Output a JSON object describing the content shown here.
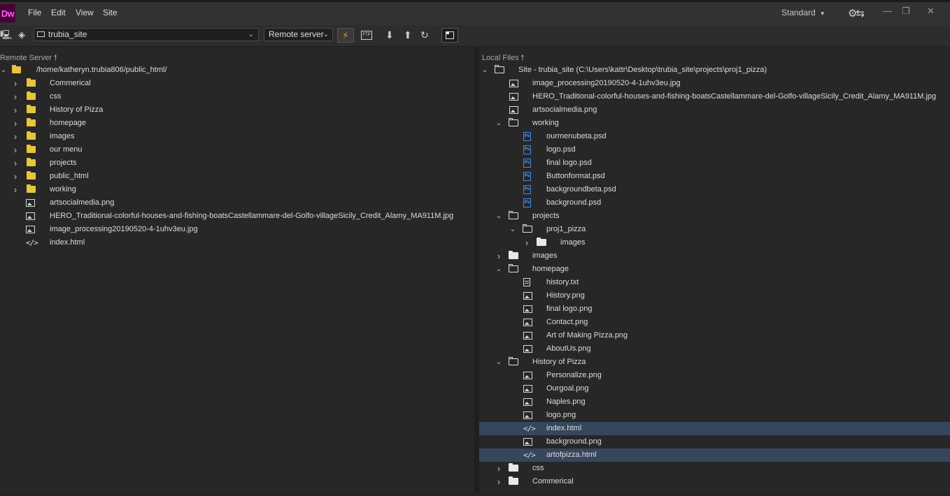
{
  "app": {
    "logo_text": "Dw",
    "accent": "#ff61f6",
    "logo_bg": "#470137"
  },
  "menu": [
    "File",
    "Edit",
    "View",
    "Site"
  ],
  "workspace": {
    "label": "Standard"
  },
  "toolbar": {
    "site_name": "trubia_site",
    "server_view": "Remote server",
    "icons": [
      "connect-icon",
      "ftp-log-icon",
      "get-down-arrow-icon",
      "put-up-arrow-icon",
      "refresh-icon",
      "expand-panel-icon"
    ]
  },
  "remote": {
    "header": "Remote Server",
    "root": "/home/katheryn.trubia806/public_html/",
    "items": [
      {
        "name": "Commerical",
        "type": "folder"
      },
      {
        "name": "css",
        "type": "folder"
      },
      {
        "name": "History of Pizza",
        "type": "folder"
      },
      {
        "name": "homepage",
        "type": "folder"
      },
      {
        "name": "images",
        "type": "folder"
      },
      {
        "name": "our menu",
        "type": "folder"
      },
      {
        "name": "projects",
        "type": "folder"
      },
      {
        "name": "public_html",
        "type": "folder"
      },
      {
        "name": "working",
        "type": "folder"
      },
      {
        "name": "artsocialmedia.png",
        "type": "image"
      },
      {
        "name": "HERO_Traditional-colorful-houses-and-fishing-boatsCastellammare-del-Golfo-villageSicily_Credit_Alamy_MA911M.jpg",
        "type": "image"
      },
      {
        "name": "image_processing20190520-4-1uhv3eu.jpg",
        "type": "image"
      },
      {
        "name": "index.html",
        "type": "code"
      }
    ]
  },
  "local": {
    "header": "Local Files",
    "root": "Site - trubia_site (C:\\Users\\kattr\\Desktop\\trubia_site\\projects\\proj1_pizza)",
    "items": [
      {
        "name": "image_processing20190520-4-1uhv3eu.jpg",
        "type": "image",
        "level": 1
      },
      {
        "name": "HERO_Traditional-colorful-houses-and-fishing-boatsCastellammare-del-Golfo-villageSicily_Credit_Alamy_MA911M.jpg",
        "type": "image",
        "level": 1
      },
      {
        "name": "artsocialmedia.png",
        "type": "image",
        "level": 1
      },
      {
        "name": "working",
        "type": "folder-open",
        "level": 1
      },
      {
        "name": "ourmenubeta.psd",
        "type": "psd",
        "level": 2
      },
      {
        "name": "logo.psd",
        "type": "psd",
        "level": 2
      },
      {
        "name": "final logo.psd",
        "type": "psd",
        "level": 2
      },
      {
        "name": "Buttonformat.psd",
        "type": "psd",
        "level": 2
      },
      {
        "name": "backgroundbeta.psd",
        "type": "psd",
        "level": 2
      },
      {
        "name": "background.psd",
        "type": "psd",
        "level": 2
      },
      {
        "name": "projects",
        "type": "folder-open",
        "level": 1
      },
      {
        "name": "proj1_pizza",
        "type": "folder-open",
        "level": 2
      },
      {
        "name": "images",
        "type": "folder",
        "level": 3
      },
      {
        "name": "images",
        "type": "folder",
        "level": 1
      },
      {
        "name": "homepage",
        "type": "folder-open",
        "level": 1
      },
      {
        "name": "history.txt",
        "type": "text",
        "level": 2
      },
      {
        "name": "History.png",
        "type": "image",
        "level": 2
      },
      {
        "name": "final logo.png",
        "type": "image",
        "level": 2
      },
      {
        "name": "Contact.png",
        "type": "image",
        "level": 2
      },
      {
        "name": "Art of Making Pizza.png",
        "type": "image",
        "level": 2
      },
      {
        "name": "AboutUs.png",
        "type": "image",
        "level": 2
      },
      {
        "name": "History of Pizza",
        "type": "folder-open",
        "level": 1
      },
      {
        "name": "Personalize.png",
        "type": "image",
        "level": 2
      },
      {
        "name": "Ourgoal.png",
        "type": "image",
        "level": 2
      },
      {
        "name": "Naples.png",
        "type": "image",
        "level": 2
      },
      {
        "name": "logo.png",
        "type": "image",
        "level": 2
      },
      {
        "name": "index.html",
        "type": "code",
        "level": 2,
        "selected": true
      },
      {
        "name": "background.png",
        "type": "image",
        "level": 2
      },
      {
        "name": "artofpizza.html",
        "type": "code",
        "level": 2,
        "selected": true
      },
      {
        "name": "css",
        "type": "folder",
        "level": 1
      },
      {
        "name": "Commerical",
        "type": "folder",
        "level": 1
      }
    ]
  }
}
